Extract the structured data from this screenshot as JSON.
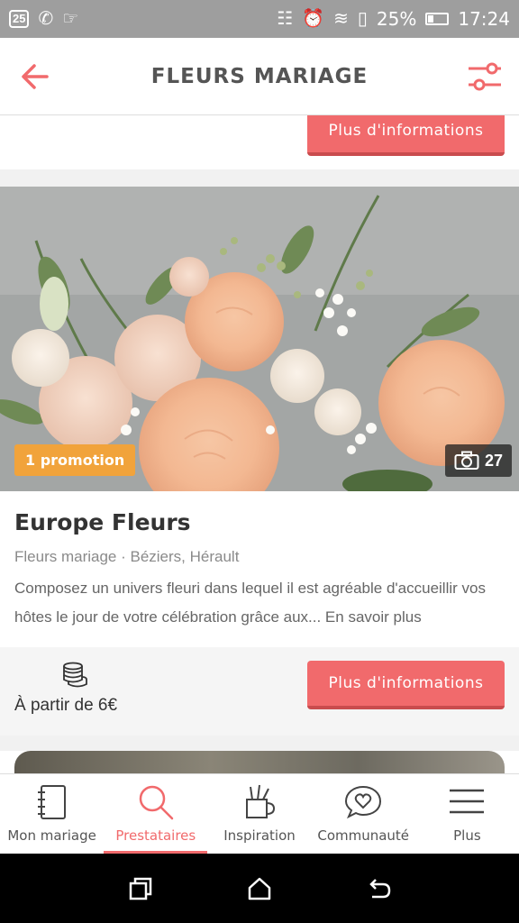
{
  "status_bar": {
    "badge": "25",
    "battery": "25%",
    "time": "17:24"
  },
  "app_bar": {
    "title": "FLEURS MARIAGE"
  },
  "previous_card": {
    "button_label": "Plus d'informations"
  },
  "card": {
    "promo_label": "1 promotion",
    "photo_count": "27",
    "name": "Europe Fleurs",
    "meta": "Fleurs mariage · Béziers, Hérault",
    "description": "Composez un univers fleuri dans lequel il est agréable d'accueillir vos hôtes le jour de votre célébration grâce aux...",
    "more_link": " En savoir plus",
    "price": "À partir de 6€",
    "button_label": "Plus d'informations"
  },
  "bottom_nav": {
    "items": [
      {
        "label": "Mon mariage",
        "icon": "notebook-icon"
      },
      {
        "label": "Prestataires",
        "icon": "search-icon"
      },
      {
        "label": "Inspiration",
        "icon": "pencil-cup-icon"
      },
      {
        "label": "Communauté",
        "icon": "heart-chat-icon"
      },
      {
        "label": "Plus",
        "icon": "menu-icon"
      }
    ],
    "active_index": 1
  },
  "colors": {
    "accent": "#f16a6c",
    "promo": "#f1a33b"
  }
}
